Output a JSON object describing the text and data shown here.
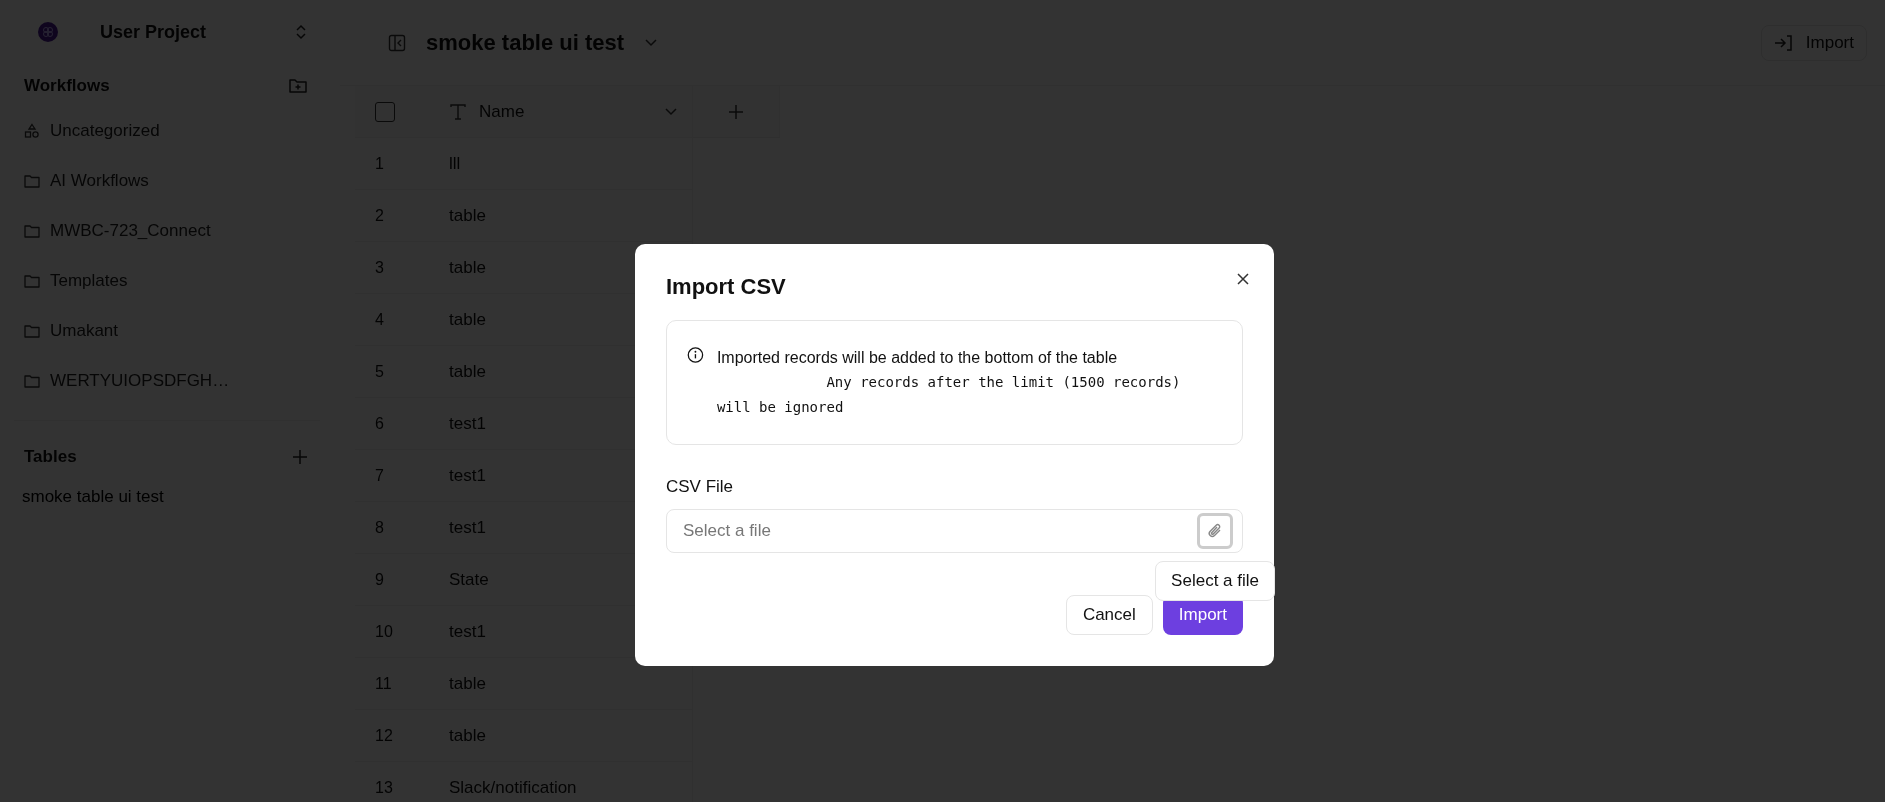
{
  "sidebar": {
    "project": "User Project",
    "workflows_title": "Workflows",
    "workflows": [
      {
        "label": "Uncategorized",
        "kind": "category"
      },
      {
        "label": "AI Workflows",
        "kind": "folder"
      },
      {
        "label": "MWBC-723_Connect",
        "kind": "folder"
      },
      {
        "label": "Templates",
        "kind": "folder"
      },
      {
        "label": "Umakant",
        "kind": "folder"
      },
      {
        "label": "WERTYUIOPSDFGH…",
        "kind": "folder"
      }
    ],
    "tables_title": "Tables",
    "tables": [
      {
        "label": "smoke table ui test"
      }
    ]
  },
  "header": {
    "title": "smoke table ui test",
    "import_button": "Import"
  },
  "table": {
    "select_all": {
      "checked": false
    },
    "columns": [
      {
        "label": "Name"
      }
    ],
    "rows": [
      {
        "number": "1",
        "name": "lll"
      },
      {
        "number": "2",
        "name": "table"
      },
      {
        "number": "3",
        "name": "table"
      },
      {
        "number": "4",
        "name": "table"
      },
      {
        "number": "5",
        "name": "table"
      },
      {
        "number": "6",
        "name": "test1"
      },
      {
        "number": "7",
        "name": "test1"
      },
      {
        "number": "8",
        "name": "test1"
      },
      {
        "number": "9",
        "name": "State"
      },
      {
        "number": "10",
        "name": "test1"
      },
      {
        "number": "11",
        "name": "table"
      },
      {
        "number": "12",
        "name": "table"
      },
      {
        "number": "13",
        "name": "Slack/notification"
      }
    ]
  },
  "dialog": {
    "title": "Import CSV",
    "message": "Imported records will be added to the bottom of the table",
    "note": "Any records after the limit (1500 records) will be ignored",
    "field_label": "CSV File",
    "placeholder": "Select a file",
    "tooltip": "Select a file",
    "buttons": [
      {
        "label": "Cancel",
        "kind": "secondary"
      },
      {
        "label": "Import",
        "kind": "primary"
      }
    ]
  }
}
